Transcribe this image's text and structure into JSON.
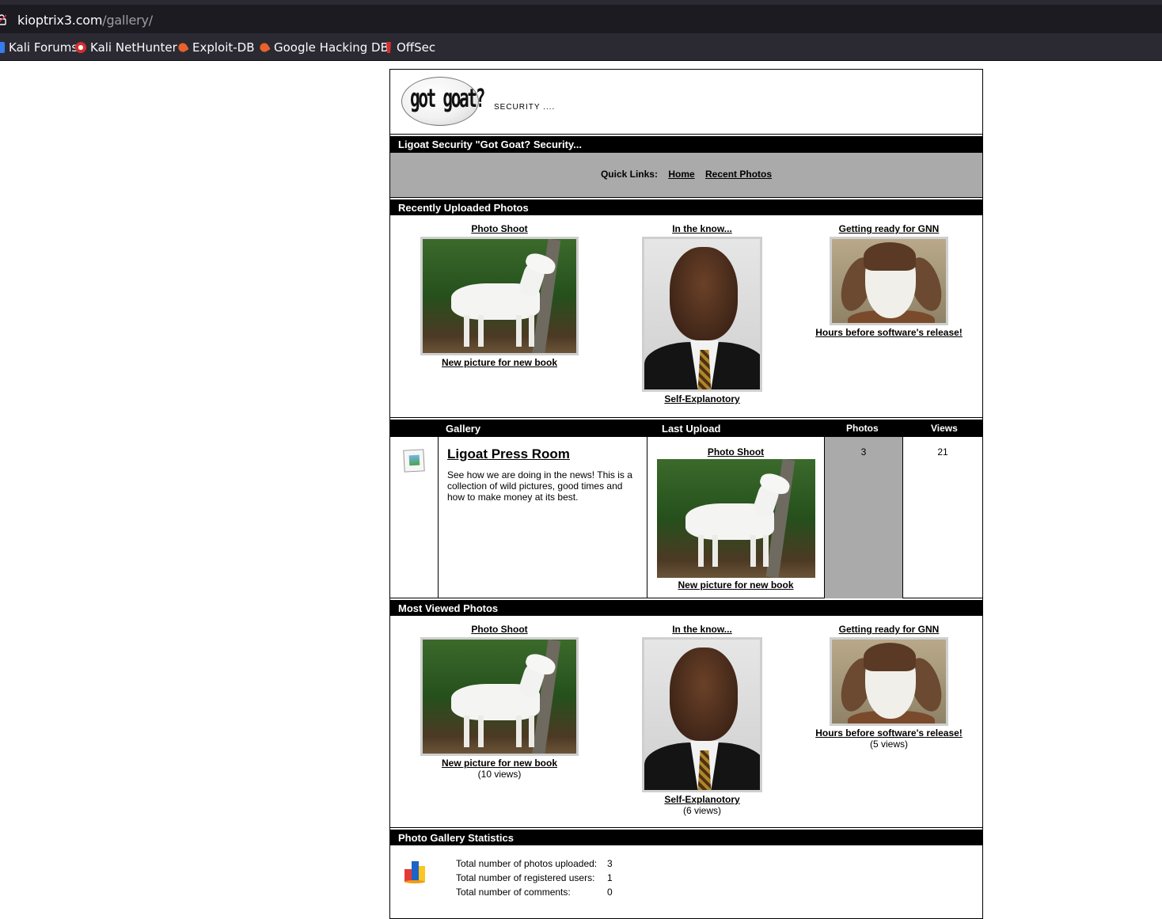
{
  "browser": {
    "url_host": "kioptrix3.com",
    "url_path": "/gallery/",
    "bookmarks": [
      "Kali Forums",
      "Kali NetHunter",
      "Exploit-DB",
      "Google Hacking DB",
      "OffSec"
    ]
  },
  "header": {
    "logo_text": "got goat?",
    "tagline": "SECURITY ...."
  },
  "title_bar": "Ligoat Security \"Got Goat? Security...",
  "quick_links": {
    "label": "Quick Links:",
    "links": [
      "Home",
      "Recent Photos"
    ]
  },
  "recent": {
    "title": "Recently Uploaded Photos",
    "items": [
      {
        "album": "Photo Shoot",
        "caption": "New picture for new book"
      },
      {
        "album": "In the know...",
        "caption": "Self-Explanotory"
      },
      {
        "album": "Getting ready for GNN",
        "caption": "Hours before software's release!"
      }
    ]
  },
  "gallery_table": {
    "headers": {
      "gallery": "Gallery",
      "last_upload": "Last Upload",
      "photos": "Photos",
      "views": "Views"
    },
    "rows": [
      {
        "name": "Ligoat Press Room",
        "description": "See how we are doing in the news! This is a collection of wild pictures, good times and how to make money at its best.",
        "last_upload_album": "Photo Shoot",
        "last_upload_caption": "New picture for new book",
        "photos": "3",
        "views": "21"
      }
    ]
  },
  "most_viewed": {
    "title": "Most Viewed Photos",
    "items": [
      {
        "album": "Photo Shoot",
        "caption": "New picture for new book",
        "views": "(10 views)"
      },
      {
        "album": "In the know...",
        "caption": "Self-Explanotory",
        "views": "(6 views)"
      },
      {
        "album": "Getting ready for GNN",
        "caption": "Hours before software's release!",
        "views": "(5 views)"
      }
    ]
  },
  "statistics": {
    "title": "Photo Gallery Statistics",
    "rows": [
      {
        "label": "Total number of photos uploaded:",
        "value": "3"
      },
      {
        "label": "Total number of registered users:",
        "value": "1"
      },
      {
        "label": "Total number of comments:",
        "value": "0"
      }
    ]
  }
}
